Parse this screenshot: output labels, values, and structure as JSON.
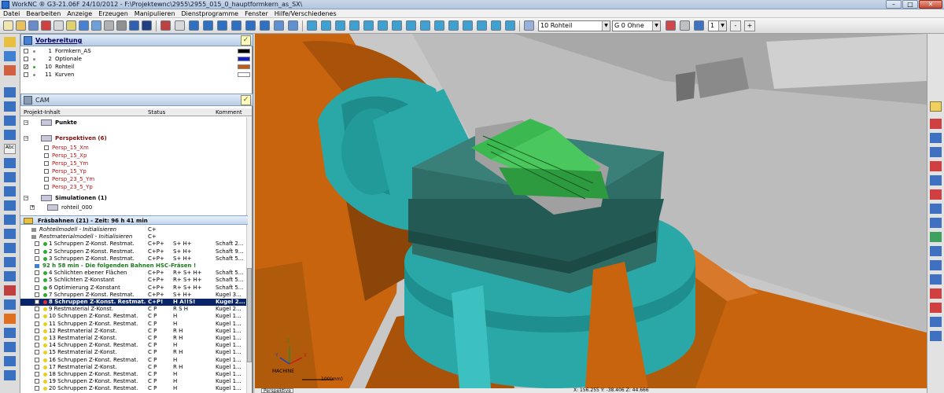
{
  "window": {
    "title": "WorkNC ® G3-21.06F  24/10/2012 - F:\\Projektewnc\\2955\\2955_015_0_hauptformkern_as_SX\\"
  },
  "menu": [
    "Datei",
    "Bearbeiten",
    "Anzeige",
    "Erzeugen",
    "Manipulieren",
    "Dienstprogramme",
    "Fenster",
    "Hilfe/Verschiedenes"
  ],
  "toolbar": {
    "layer_combo": "10  Rohteil",
    "group_combo": "G  0 Ohne",
    "spin_value": "1",
    "minus_label": "-",
    "plus_label": "+"
  },
  "preparation_panel": {
    "title": "Vorbereitung",
    "layers": [
      {
        "number": "1",
        "name": "Formkern_AS",
        "checked": false,
        "color": "#000000"
      },
      {
        "number": "2",
        "name": "Optionale",
        "checked": false,
        "color": "#1020d0"
      },
      {
        "number": "10",
        "name": "Rohteil",
        "checked": true,
        "color": "#c85a10"
      },
      {
        "number": "11",
        "name": "Kurven",
        "checked": false,
        "color": "#ffffff"
      }
    ]
  },
  "cam_panel": {
    "title": "CAM",
    "columns": [
      "Projekt-Inhalt",
      "Status",
      "Komment"
    ],
    "tree": {
      "punkte": "Punkte",
      "perspektiven": "Perspektiven (6)",
      "perspective_items": [
        "Persp_15_Xm",
        "Persp_15_Xp",
        "Persp_15_Ym",
        "Persp_15_Yp",
        "Persp_23_5_Ym",
        "Persp_23_5_Yp"
      ],
      "simulationen": "Simulationen (1)",
      "simulation_item": "rohteil_000"
    },
    "fraesbahnen_header": "Fräsbahnen (21) - Zeit: 96 h 41 min",
    "toolpaths": [
      {
        "name": "Rohteilmodell - Initialisieren",
        "status": "C+",
        "flags": "",
        "comment": "",
        "italic": true
      },
      {
        "name": "Restmaterialmodell - Initialisieren",
        "status": "C+",
        "flags": "",
        "comment": "",
        "italic": true
      },
      {
        "name": "1 Schruppen Z-Konst. Restmat.",
        "status": "C+P+",
        "flags": "S+ H+",
        "comment": "Schaft 2...",
        "dot": "#2eaa2e"
      },
      {
        "name": "2 Schruppen Z-Konst. Restmat.",
        "status": "C+P+",
        "flags": "S+ H+",
        "comment": "Schaft 9...",
        "dot": "#2eaa2e"
      },
      {
        "name": "3 Schruppen Z-Konst. Restmat.",
        "status": "C+P+",
        "flags": "S+ H+",
        "comment": "Schaft 5...",
        "dot": "#2eaa2e"
      },
      {
        "name": "92 h 58 min - Die folgenden Bahnen HSC-Fräsen !",
        "status": "",
        "flags": "",
        "comment": "",
        "note": true
      },
      {
        "name": "4 Schlichten ebener Flächen",
        "status": "C+P+",
        "flags": "R+ S+ H+",
        "comment": "Schaft 5...",
        "dot": "#2eaa2e"
      },
      {
        "name": "5 Schlichten Z-Konstant",
        "status": "C+P+",
        "flags": "R+ S+ H+",
        "comment": "Schaft 5...",
        "dot": "#2eaa2e"
      },
      {
        "name": "6 Optimierung Z-Konstant",
        "status": "C+P+",
        "flags": "R+ S+ H+",
        "comment": "Schaft 5...",
        "dot": "#2eaa2e"
      },
      {
        "name": "7 Schruppen Z-Konst. Restmat.",
        "status": "C+P+",
        "flags": "S+ H+",
        "comment": "Kugel 3...",
        "dot": "#2eaa2e"
      },
      {
        "name": "8 Schruppen Z-Konst. Restmat.",
        "status": "C+P!",
        "flags": "H  A!!S!",
        "comment": "Kugel 2...",
        "dot": "#e03030",
        "selected": true
      },
      {
        "name": "9 Restmaterial Z-Konst.",
        "status": "C P",
        "flags": "R  S  H",
        "comment": "Kugel 2...",
        "dot": "#e8d020"
      },
      {
        "name": "10 Schruppen Z-Konst. Restmat.",
        "status": "C P",
        "flags": "H",
        "comment": "Kugel 1...",
        "dot": "#e8d020"
      },
      {
        "name": "11 Schruppen Z-Konst. Restmat.",
        "status": "C P",
        "flags": "H",
        "comment": "Kugel 1...",
        "dot": "#e8d020"
      },
      {
        "name": "12 Restmaterial Z-Konst.",
        "status": "C P",
        "flags": "R    H",
        "comment": "Kugel 1...",
        "dot": "#e8d020"
      },
      {
        "name": "13 Restmaterial Z-Konst.",
        "status": "C P",
        "flags": "R    H",
        "comment": "Kugel 1...",
        "dot": "#e8d020"
      },
      {
        "name": "14 Schruppen Z-Konst. Restmat.",
        "status": "C P",
        "flags": "H",
        "comment": "Kugel 1...",
        "dot": "#e8d020"
      },
      {
        "name": "15 Restmaterial Z-Konst.",
        "status": "C P",
        "flags": "R    H",
        "comment": "Kugel 1...",
        "dot": "#e8d020"
      },
      {
        "name": "16 Schruppen Z-Konst. Restmat.",
        "status": "C P",
        "flags": "H",
        "comment": "Kugel 1...",
        "dot": "#e8d020"
      },
      {
        "name": "17 Restmaterial Z-Konst.",
        "status": "C P",
        "flags": "R    H",
        "comment": "Kugel 1...",
        "dot": "#e8d020"
      },
      {
        "name": "18 Schruppen Z-Konst. Restmat.",
        "status": "C P",
        "flags": "H",
        "comment": "Kugel 1...",
        "dot": "#e8d020"
      },
      {
        "name": "19 Schruppen Z-Konst. Restmat.",
        "status": "C P",
        "flags": "H",
        "comment": "Kugel 1...",
        "dot": "#e8d020"
      },
      {
        "name": "20 Schruppen Z-Konst. Restmat.",
        "status": "C P",
        "flags": "H",
        "comment": "Kugel 1...",
        "dot": "#e8d020"
      }
    ]
  },
  "viewport": {
    "axis_label": "MACHINE",
    "axis_z": "Z",
    "axis_y": "Y",
    "axis_x": "X",
    "scale_label": "100(mm)",
    "view_tab": "Perspektive",
    "coords": "X: 156.255   Y: -38.406   Z: 44.666"
  },
  "colors": {
    "machine_orange": "#c8640e",
    "machine_teal": "#2aa8a8",
    "fixture_green": "#2e6e66",
    "part_green": "#3cb850",
    "wall_gray": "#bcbcbc"
  }
}
